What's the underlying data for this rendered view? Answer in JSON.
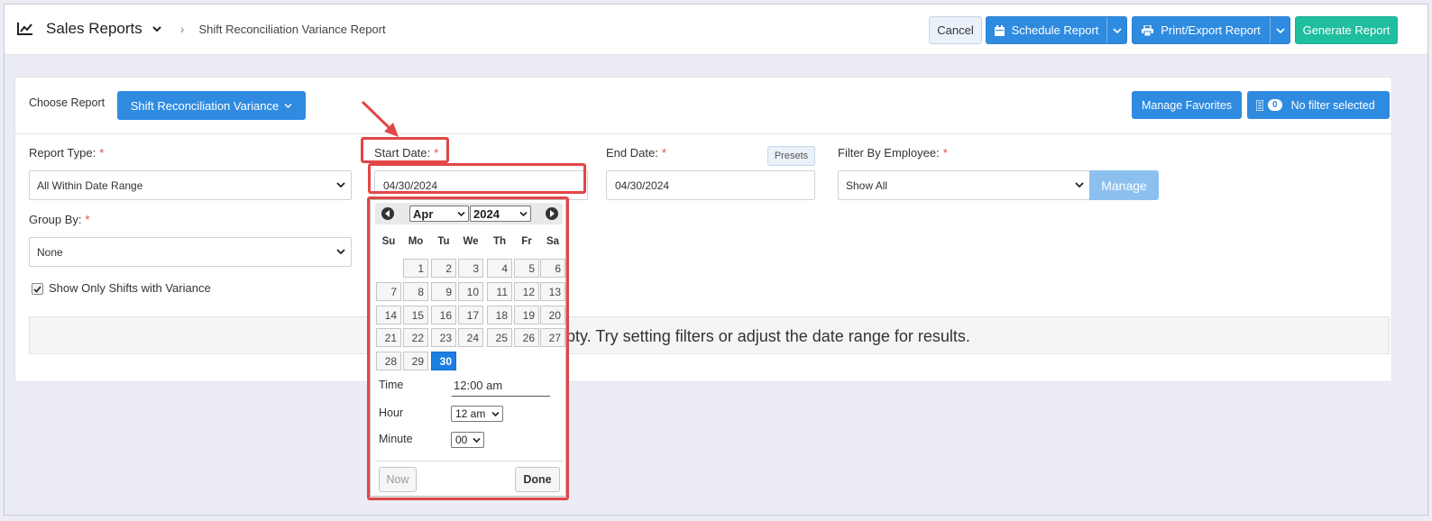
{
  "header": {
    "title": "Sales Reports",
    "breadcrumb": "Shift Reconciliation Variance Report",
    "cancel_label": "Cancel",
    "schedule_label": "Schedule Report",
    "print_label": "Print/Export Report",
    "generate_label": "Generate Report"
  },
  "report": {
    "choose_label": "Choose Report",
    "selected_report": "Shift Reconciliation Variance",
    "manage_favorites_label": "Manage Favorites",
    "filter_count": "0",
    "filter_label": "No filter selected"
  },
  "form": {
    "report_type_label": "Report Type:",
    "report_type_value": "All Within Date Range",
    "start_date_label": "Start Date:",
    "start_date_value": "04/30/2024",
    "end_date_label": "End Date:",
    "end_date_value": "04/30/2024",
    "presets_label": "Presets",
    "employee_label": "Filter By Employee:",
    "employee_value": "Show All",
    "manage_label": "Manage",
    "group_by_label": "Group By:",
    "group_by_value": "None",
    "required_marker": "*",
    "variance_checkbox_label": "Show Only Shifts with Variance",
    "variance_checked": true,
    "empty_message": "pty. Try setting filters or adjust the date range for results."
  },
  "datepicker": {
    "month": "Apr",
    "year": "2024",
    "weekdays": [
      "Su",
      "Mo",
      "Tu",
      "We",
      "Th",
      "Fr",
      "Sa"
    ],
    "days": [
      "1",
      "2",
      "3",
      "4",
      "5",
      "6",
      "7",
      "8",
      "9",
      "10",
      "11",
      "12",
      "13",
      "14",
      "15",
      "16",
      "17",
      "18",
      "19",
      "20",
      "21",
      "22",
      "23",
      "24",
      "25",
      "26",
      "27",
      "28",
      "29",
      "30"
    ],
    "selected_day": "30",
    "time_label": "Time",
    "time_value": "12:00 am",
    "hour_label": "Hour",
    "hour_value": "12 am",
    "minute_label": "Minute",
    "minute_value": "00",
    "now_label": "Now",
    "done_label": "Done"
  },
  "colors": {
    "primary": "#2f8be0",
    "generate": "#1fbe9f",
    "highlight": "#e24646",
    "selected_day": "#1b7fe3"
  }
}
